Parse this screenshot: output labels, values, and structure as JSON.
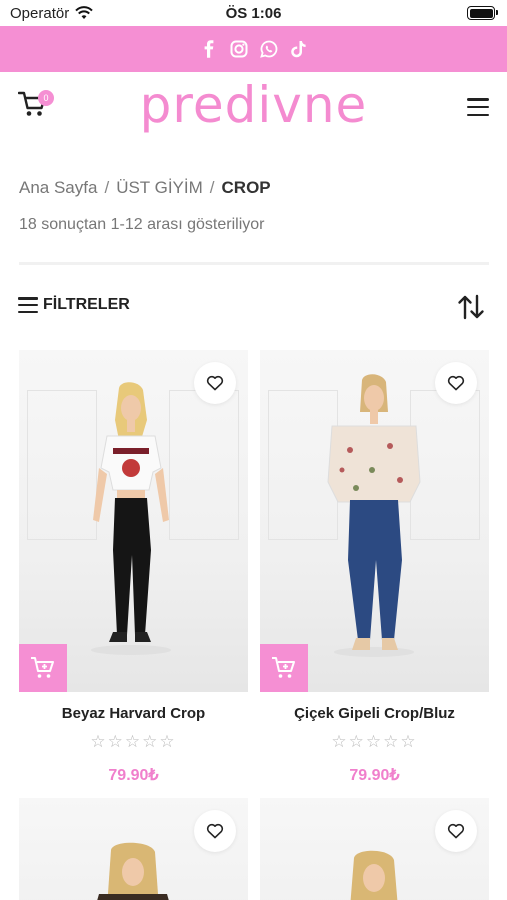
{
  "status_bar": {
    "carrier": "Operatör",
    "time": "ÖS 1:06"
  },
  "social": {
    "icons": [
      "facebook-icon",
      "instagram-icon",
      "whatsapp-icon",
      "tiktok-icon"
    ]
  },
  "header": {
    "logo_text": "predivne",
    "cart_count": "0"
  },
  "breadcrumb": {
    "items": [
      "Ana Sayfa",
      "ÜST GİYİM"
    ],
    "separator": "/",
    "current": "CROP"
  },
  "results": {
    "summary": "18 sonuçtan 1-12 arası gösteriliyor"
  },
  "toolbar": {
    "filter_label": "FİLTRELER"
  },
  "products": [
    {
      "name": "Beyaz Harvard Crop",
      "price": "79.90₺",
      "rating": 0,
      "stars": "☆☆☆☆☆"
    },
    {
      "name": "Çiçek Gipeli Crop/Bluz",
      "price": "79.90₺",
      "rating": 0,
      "stars": "☆☆☆☆☆"
    }
  ],
  "colors": {
    "brand_pink": "#f58fd3",
    "price_pink": "#f07fcc",
    "text_dark": "#222222",
    "text_muted": "#777777"
  }
}
